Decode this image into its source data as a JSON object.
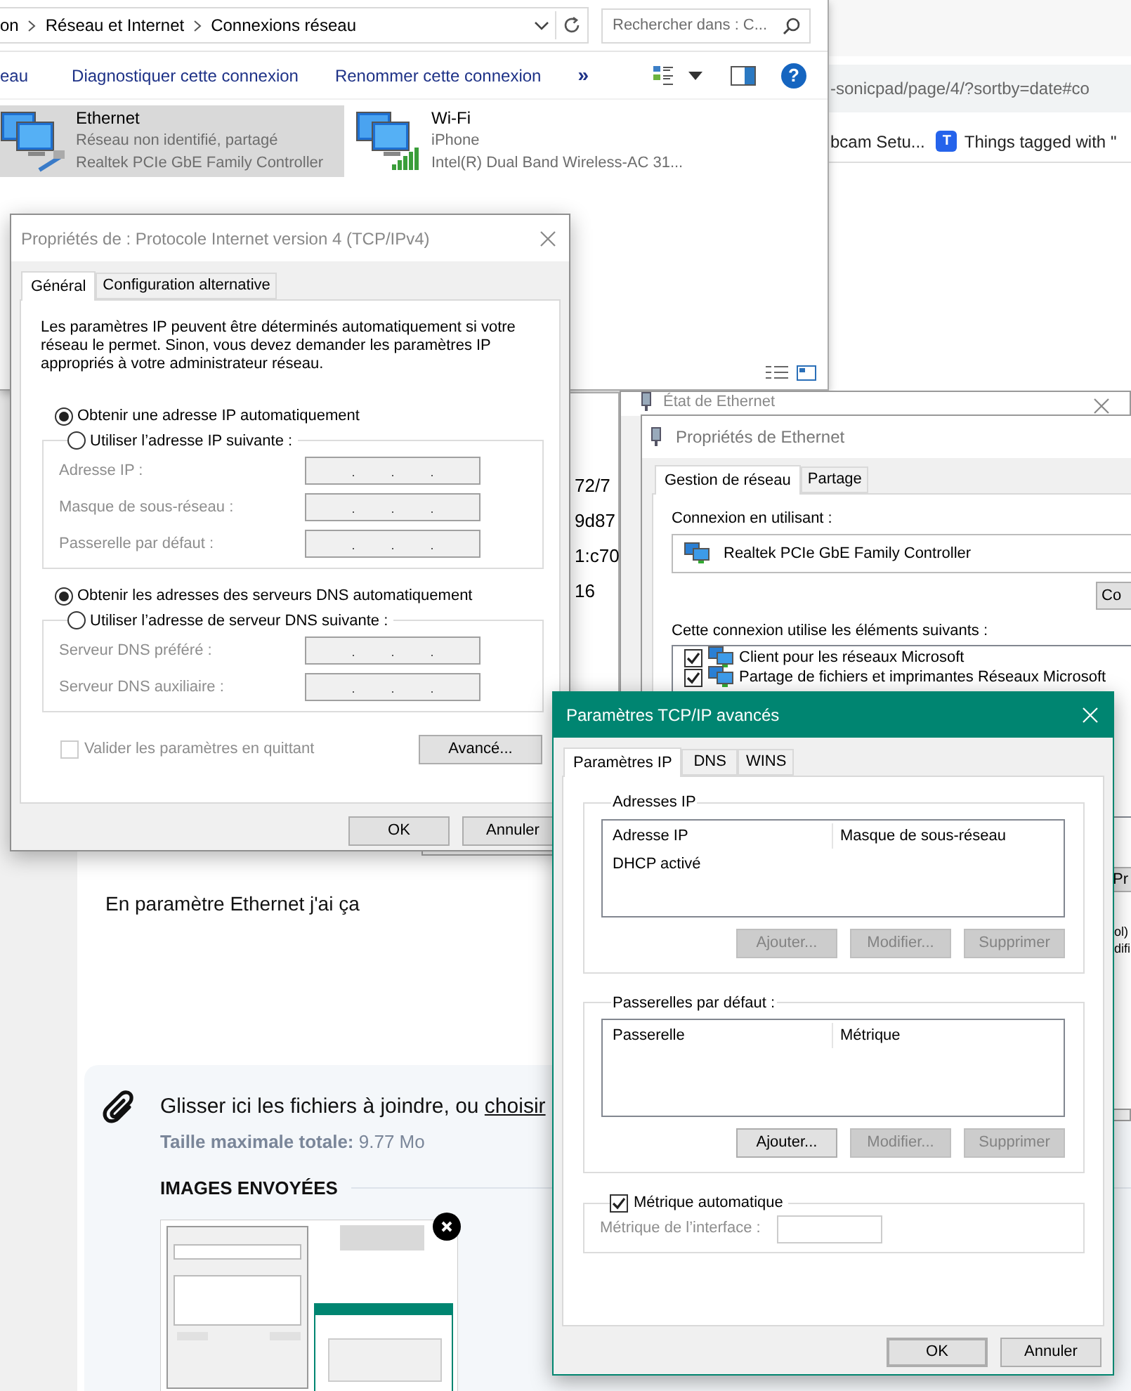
{
  "browser": {
    "url": "-sonicpad/page/4/?sortby=date#co",
    "bookmarks": [
      {
        "label": "bcam Setu...",
        "kind": "plain"
      },
      {
        "label": "Things tagged with \"",
        "kind": "tagged",
        "icon_letter": "T"
      }
    ]
  },
  "explorer": {
    "breadcrumb": [
      "on",
      "Réseau et Internet",
      "Connexions réseau"
    ],
    "search": {
      "placeholder": "Rechercher dans : C..."
    },
    "toolbar": [
      "eau",
      "Diagnostiquer cette connexion",
      "Renommer cette connexion"
    ],
    "more": "»",
    "help": "?",
    "connections": [
      {
        "name": "Ethernet",
        "status": "Réseau non identifié, partagé",
        "device": "Realtek PCIe GbE Family Controller",
        "kind": "wired",
        "selected": true
      },
      {
        "name": "Wi-Fi",
        "status": "iPhone",
        "device": "Intel(R) Dual Band Wireless-AC 31...",
        "kind": "wireless",
        "selected": false
      }
    ]
  },
  "details_window": {
    "lines": [
      "72/7",
      "9d87",
      "1:c70",
      "16"
    ]
  },
  "ethernet_status": {
    "title": "État de Ethernet"
  },
  "ethernet_properties": {
    "title": "Propriétés de Ethernet",
    "tabs": [
      {
        "label": "Gestion de réseau",
        "selected": true
      },
      {
        "label": "Partage",
        "selected": false
      }
    ],
    "connect_using_label": "Connexion en utilisant :",
    "adapter": "Realtek PCIe GbE Family Controller",
    "configure_button": "Co",
    "items_label": "Cette connexion utilise les éléments suivants :",
    "items": [
      {
        "label": "Client pour les réseaux Microsoft",
        "checked": true
      },
      {
        "label": "Partage de fichiers et imprimantes Réseaux Microsoft",
        "checked": true
      }
    ],
    "properties_button": "Pr",
    "description": [
      "ol)",
      "difi"
    ]
  },
  "ipv4_dialog": {
    "title": "Propriétés de : Protocole Internet version 4 (TCP/IPv4)",
    "tabs": [
      {
        "label": "Général",
        "selected": true
      },
      {
        "label": "Configuration alternative",
        "selected": false
      }
    ],
    "description": "Les paramètres IP peuvent être déterminés automatiquement si votre réseau le permet. Sinon, vous devez demander les paramètres IP appropriés à votre administrateur réseau.",
    "ip_auto": {
      "label": "Obtenir une adresse IP automatiquement",
      "selected": true
    },
    "ip_manual": {
      "label": "Utiliser l’adresse IP suivante :",
      "selected": false,
      "fields": [
        {
          "label": "Adresse IP :",
          "disabled": true
        },
        {
          "label": "Masque de sous-réseau :",
          "disabled": true
        },
        {
          "label": "Passerelle par défaut :",
          "disabled": true
        }
      ]
    },
    "dns_auto": {
      "label": "Obtenir les adresses des serveurs DNS automatiquement",
      "selected": true
    },
    "dns_manual": {
      "label": "Utiliser l’adresse de serveur DNS suivante :",
      "selected": false,
      "fields": [
        {
          "label": "Serveur DNS préféré :",
          "disabled": true
        },
        {
          "label": "Serveur DNS auxiliaire :",
          "disabled": true
        }
      ]
    },
    "validate": {
      "label": "Valider les paramètres en quittant",
      "checked": false,
      "disabled": true
    },
    "advanced_button": "Avancé...",
    "buttons": [
      "OK",
      "Annuler"
    ]
  },
  "advanced_dialog": {
    "title": "Paramètres TCP/IP avancés",
    "tabs": [
      {
        "label": "Paramètres IP",
        "selected": true
      },
      {
        "label": "DNS",
        "selected": false
      },
      {
        "label": "WINS",
        "selected": false
      }
    ],
    "groups": [
      {
        "title": "Adresses IP",
        "columns": [
          "Adresse IP",
          "Masque de sous-réseau"
        ],
        "rows": [
          [
            "DHCP activé"
          ]
        ],
        "buttons": [
          {
            "label": "Ajouter...",
            "disabled": true
          },
          {
            "label": "Modifier...",
            "disabled": true
          },
          {
            "label": "Supprimer",
            "disabled": true
          }
        ]
      },
      {
        "title": "Passerelles par défaut :",
        "columns": [
          "Passerelle",
          "Métrique"
        ],
        "buttons": [
          {
            "label": "Ajouter...",
            "disabled": false
          },
          {
            "label": "Modifier...",
            "disabled": true
          },
          {
            "label": "Supprimer",
            "disabled": true
          }
        ]
      }
    ],
    "metric": {
      "label": "Métrique automatique",
      "checked": true,
      "field_label": "Métrique de l’interface :",
      "field_disabled": true
    },
    "buttons": [
      {
        "label": "OK",
        "default": true
      },
      {
        "label": "Annuler",
        "default": false
      }
    ]
  },
  "post": {
    "text": "En paramètre Ethernet j'ai ça"
  },
  "attachments": {
    "drop_text": "Glisser ici les fichiers à joindre, ou",
    "choose_link": "choisir",
    "max_label": "Taille maximale totale:",
    "max_value": "9.77 Mo",
    "heading": "IMAGES ENVOYÉES"
  }
}
